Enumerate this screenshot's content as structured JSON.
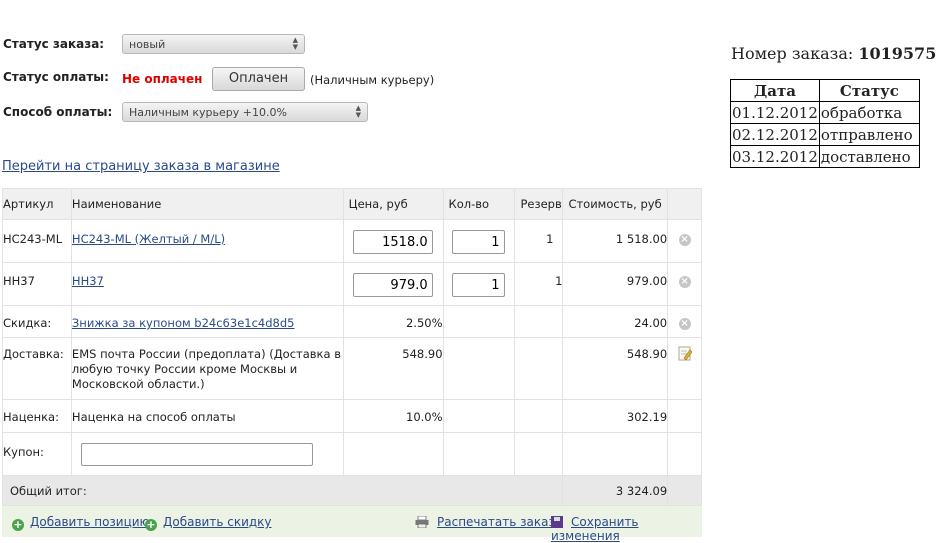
{
  "order": {
    "status_label": "Статус заказа:",
    "status_value": "новый",
    "payment_status_label": "Статус оплаты:",
    "payment_status_value": "Не оплачен",
    "paid_button": "Оплачен",
    "payment_note": "(Наличным курьеру)",
    "payment_method_label": "Способ оплаты:",
    "payment_method_value": "Наличным курьеру +10.0%",
    "store_link": "Перейти на страницу заказа в магазине",
    "number_label": "Номер заказа:",
    "number_value": "1019575"
  },
  "table": {
    "headers": [
      "Артикул",
      "Наименование",
      "Цена, руб",
      "Кол-во",
      "Резерв",
      "Стоимость, руб"
    ],
    "items": [
      {
        "sku": "HC243-ML",
        "name": "HC243-ML (Желтый / M/L)",
        "price": "1518.0",
        "qty": "1",
        "reserve": "1",
        "cost": "1 518.00"
      },
      {
        "sku": "HH37",
        "name": "HH37",
        "price": "979.0",
        "qty": "1",
        "reserve": "1",
        "cost": "979.00"
      }
    ],
    "discount": {
      "label": "Скидка:",
      "name": "Знижка за купоном b24c63e1c4d8d5",
      "price": "2.50%",
      "cost": "24.00"
    },
    "delivery": {
      "label": "Доставка:",
      "name": "EMS почта России (предоплата) (Доставка в любую точку России кроме Москвы и Московской области.)",
      "price": "548.90",
      "cost": "548.90"
    },
    "markup": {
      "label": "Наценка:",
      "name": "Наценка на способ оплаты",
      "price": "10.0%",
      "cost": "302.19"
    },
    "coupon": {
      "label": "Купон:",
      "value": ""
    },
    "total": {
      "label": "Общий итог:",
      "value": "3 324.09"
    }
  },
  "footer": {
    "add_item": "Добавить позицию",
    "add_discount": "Добавить скидку",
    "print": "Распечатать заказ",
    "save": "Сохранить изменения"
  },
  "history": {
    "headers": [
      "Дата",
      "Статус"
    ],
    "rows": [
      {
        "date": "01.12.2012",
        "status": "обработка"
      },
      {
        "date": "02.12.2012",
        "status": "отправлено"
      },
      {
        "date": "03.12.2012",
        "status": "доставлено"
      }
    ]
  },
  "colors": {
    "unpaid": "#e00000",
    "link": "#2a4a8a",
    "footer_bg": "#ecf3e5",
    "add_icon": "#4aa34a"
  },
  "icons": [
    "chevron-updown-icon",
    "delete-icon",
    "edit-note-icon",
    "plus-icon",
    "printer-icon",
    "save-icon"
  ]
}
